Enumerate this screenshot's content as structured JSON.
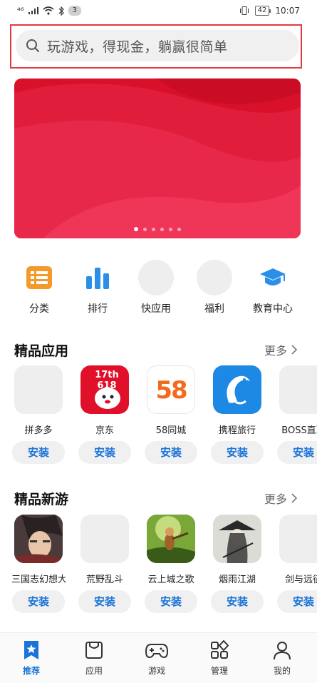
{
  "status_bar": {
    "network": "⁴⁶",
    "notification_count": "3",
    "battery": "42",
    "time": "10:07"
  },
  "search": {
    "placeholder": "玩游戏，得现金，躺赢很简单"
  },
  "banner": {
    "dots": 6,
    "active_dot": 0
  },
  "quick_links": [
    {
      "label": "分类",
      "icon": "category-icon"
    },
    {
      "label": "排行",
      "icon": "ranking-icon"
    },
    {
      "label": "快应用",
      "icon": "quick-app-icon"
    },
    {
      "label": "福利",
      "icon": "welfare-icon"
    },
    {
      "label": "教育中心",
      "icon": "graduation-cap-icon"
    }
  ],
  "featured_apps": {
    "title": "精品应用",
    "more": "更多",
    "items": [
      {
        "name": "拼多多",
        "action": "安装"
      },
      {
        "name": "京东",
        "action": "安装",
        "icon_text": "17th 618"
      },
      {
        "name": "58同城",
        "action": "安装",
        "icon_text": "58"
      },
      {
        "name": "携程旅行",
        "action": "安装"
      },
      {
        "name": "BOSS直聘",
        "action": "安装"
      }
    ]
  },
  "featured_games": {
    "title": "精品新游",
    "more": "更多",
    "items": [
      {
        "name": "三国志幻想大陆",
        "action": "安装"
      },
      {
        "name": "荒野乱斗",
        "action": "安装"
      },
      {
        "name": "云上城之歌",
        "action": "安装"
      },
      {
        "name": "烟雨江湖",
        "action": "安装"
      },
      {
        "name": "剑与远征",
        "action": "安装"
      }
    ]
  },
  "bottom_nav": [
    {
      "label": "推荐",
      "active": true
    },
    {
      "label": "应用",
      "active": false
    },
    {
      "label": "游戏",
      "active": false
    },
    {
      "label": "管理",
      "active": false
    },
    {
      "label": "我的",
      "active": false
    }
  ],
  "colors": {
    "accent": "#1a73d9",
    "highlight_frame": "#e0393f",
    "banner": "#d8102a"
  }
}
